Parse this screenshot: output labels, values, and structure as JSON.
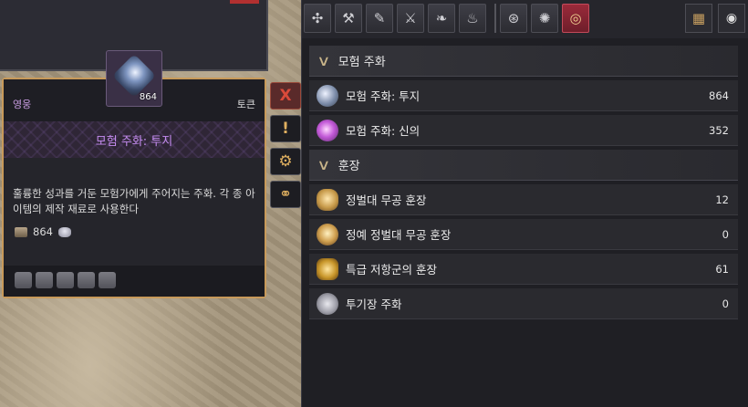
{
  "tooltip": {
    "category": "영웅",
    "type": "토큰",
    "item_count": "864",
    "title": "모험 주화: 투지",
    "description": "훌륭한 성과를 거둔 모험가에게 주어지는 주화. 각 종 아이템의 제작 재료로 사용한다",
    "quantity": "864",
    "side_buttons": {
      "close": "X",
      "info": "!",
      "box": "⚙",
      "link": "⚭"
    },
    "actions": [
      "broom-icon",
      "cube-icon",
      "scale-icon",
      "flask-icon",
      "trash-icon"
    ]
  },
  "toolbar": {
    "tabs": [
      "✣",
      "⚒",
      "✎",
      "⚔",
      "❧",
      "♨",
      "⊛",
      "✺",
      "◎"
    ],
    "grid_icon": "▦",
    "eye_icon": "◉"
  },
  "sections": [
    {
      "title": "모험 주화",
      "items": [
        {
          "name": "모험 주화: 투지",
          "value": "864",
          "icon": "silver"
        },
        {
          "name": "모험 주화: 신의",
          "value": "352",
          "icon": "purple"
        }
      ]
    },
    {
      "title": "훈장",
      "items": [
        {
          "name": "정벌대 무공 훈장",
          "value": "12",
          "icon": "medal1"
        },
        {
          "name": "정예 정벌대 무공 훈장",
          "value": "0",
          "icon": "medal2"
        },
        {
          "name": "특급 저항군의 훈장",
          "value": "61",
          "icon": "horn"
        },
        {
          "name": "투기장 주화",
          "value": "0",
          "icon": "arena"
        }
      ]
    }
  ],
  "colors": {
    "accent_gold": "#c89a5a",
    "title_purple": "#c58cf0",
    "active_tab": "#9a2a3a"
  }
}
